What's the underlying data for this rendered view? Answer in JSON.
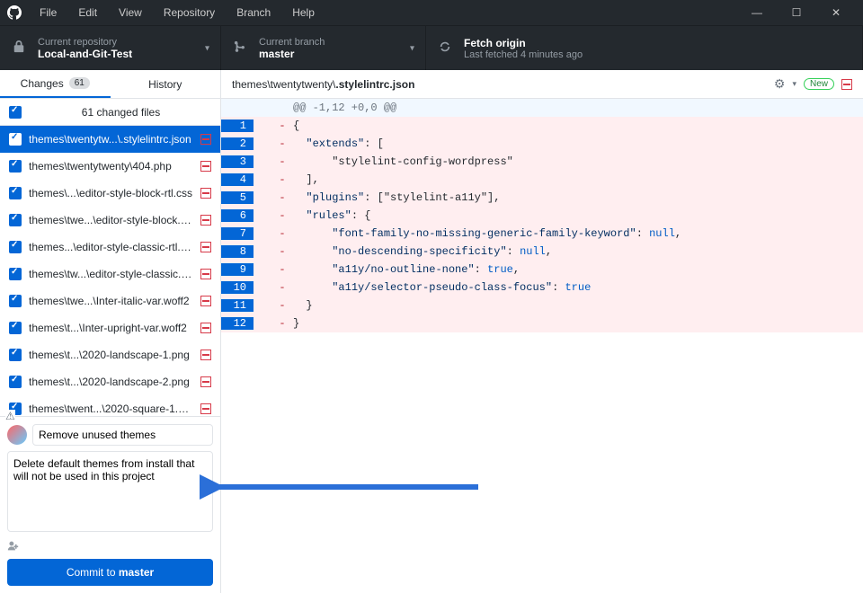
{
  "menu": [
    "File",
    "Edit",
    "View",
    "Repository",
    "Branch",
    "Help"
  ],
  "toolbar": {
    "repo": {
      "label": "Current repository",
      "value": "Local-and-Git-Test"
    },
    "branch": {
      "label": "Current branch",
      "value": "master"
    },
    "fetch": {
      "label": "Fetch origin",
      "value": "Last fetched 4 minutes ago"
    }
  },
  "tabs": {
    "changes": {
      "label": "Changes",
      "count": "61"
    },
    "history": {
      "label": "History"
    }
  },
  "files_header": "61 changed files",
  "files": [
    {
      "name": "themes\\twentytw...\\.stylelintrc.json",
      "selected": true
    },
    {
      "name": "themes\\twentytwenty\\404.php"
    },
    {
      "name": "themes\\...\\editor-style-block-rtl.css"
    },
    {
      "name": "themes\\twe...\\editor-style-block.css"
    },
    {
      "name": "themes...\\editor-style-classic-rtl.css"
    },
    {
      "name": "themes\\tw...\\editor-style-classic.css"
    },
    {
      "name": "themes\\twe...\\Inter-italic-var.woff2"
    },
    {
      "name": "themes\\t...\\Inter-upright-var.woff2"
    },
    {
      "name": "themes\\t...\\2020-landscape-1.png"
    },
    {
      "name": "themes\\t...\\2020-landscape-2.png"
    },
    {
      "name": "themes\\twent...\\2020-square-1.png"
    }
  ],
  "commit": {
    "summary": "Remove unused themes",
    "description": "Delete default themes from install that will not be used in this project",
    "button_prefix": "Commit to ",
    "button_branch": "master"
  },
  "diff": {
    "path_dir": "themes\\twentytwenty\\",
    "path_file": ".stylelintrc.json",
    "new_label": "New",
    "hunk": "@@ -1,12 +0,0 @@",
    "lines": [
      {
        "n": "1",
        "t": "{"
      },
      {
        "n": "2",
        "t": "  \"extends\": ["
      },
      {
        "n": "3",
        "t": "      \"stylelint-config-wordpress\""
      },
      {
        "n": "4",
        "t": "  ],"
      },
      {
        "n": "5",
        "t": "  \"plugins\": [\"stylelint-a11y\"],"
      },
      {
        "n": "6",
        "t": "  \"rules\": {"
      },
      {
        "n": "7",
        "t": "      \"font-family-no-missing-generic-family-keyword\": null,"
      },
      {
        "n": "8",
        "t": "      \"no-descending-specificity\": null,"
      },
      {
        "n": "9",
        "t": "      \"a11y/no-outline-none\": true,"
      },
      {
        "n": "10",
        "t": "      \"a11y/selector-pseudo-class-focus\": true"
      },
      {
        "n": "11",
        "t": "  }"
      },
      {
        "n": "12",
        "t": "}"
      }
    ]
  }
}
